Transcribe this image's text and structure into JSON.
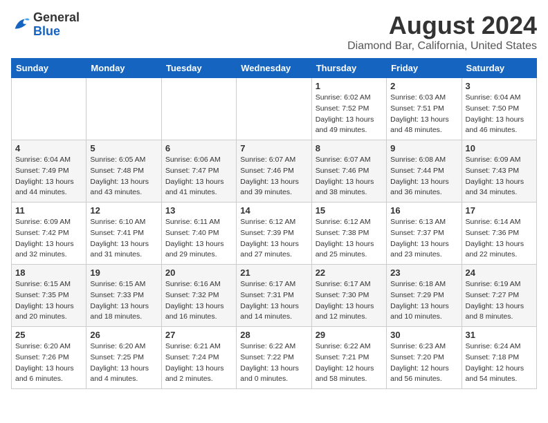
{
  "header": {
    "logo_general": "General",
    "logo_blue": "Blue",
    "month_title": "August 2024",
    "location": "Diamond Bar, California, United States"
  },
  "weekdays": [
    "Sunday",
    "Monday",
    "Tuesday",
    "Wednesday",
    "Thursday",
    "Friday",
    "Saturday"
  ],
  "weeks": [
    [
      {
        "day": "",
        "sunrise": "",
        "sunset": "",
        "daylight": ""
      },
      {
        "day": "",
        "sunrise": "",
        "sunset": "",
        "daylight": ""
      },
      {
        "day": "",
        "sunrise": "",
        "sunset": "",
        "daylight": ""
      },
      {
        "day": "",
        "sunrise": "",
        "sunset": "",
        "daylight": ""
      },
      {
        "day": "1",
        "sunrise": "Sunrise: 6:02 AM",
        "sunset": "Sunset: 7:52 PM",
        "daylight": "Daylight: 13 hours and 49 minutes."
      },
      {
        "day": "2",
        "sunrise": "Sunrise: 6:03 AM",
        "sunset": "Sunset: 7:51 PM",
        "daylight": "Daylight: 13 hours and 48 minutes."
      },
      {
        "day": "3",
        "sunrise": "Sunrise: 6:04 AM",
        "sunset": "Sunset: 7:50 PM",
        "daylight": "Daylight: 13 hours and 46 minutes."
      }
    ],
    [
      {
        "day": "4",
        "sunrise": "Sunrise: 6:04 AM",
        "sunset": "Sunset: 7:49 PM",
        "daylight": "Daylight: 13 hours and 44 minutes."
      },
      {
        "day": "5",
        "sunrise": "Sunrise: 6:05 AM",
        "sunset": "Sunset: 7:48 PM",
        "daylight": "Daylight: 13 hours and 43 minutes."
      },
      {
        "day": "6",
        "sunrise": "Sunrise: 6:06 AM",
        "sunset": "Sunset: 7:47 PM",
        "daylight": "Daylight: 13 hours and 41 minutes."
      },
      {
        "day": "7",
        "sunrise": "Sunrise: 6:07 AM",
        "sunset": "Sunset: 7:46 PM",
        "daylight": "Daylight: 13 hours and 39 minutes."
      },
      {
        "day": "8",
        "sunrise": "Sunrise: 6:07 AM",
        "sunset": "Sunset: 7:46 PM",
        "daylight": "Daylight: 13 hours and 38 minutes."
      },
      {
        "day": "9",
        "sunrise": "Sunrise: 6:08 AM",
        "sunset": "Sunset: 7:44 PM",
        "daylight": "Daylight: 13 hours and 36 minutes."
      },
      {
        "day": "10",
        "sunrise": "Sunrise: 6:09 AM",
        "sunset": "Sunset: 7:43 PM",
        "daylight": "Daylight: 13 hours and 34 minutes."
      }
    ],
    [
      {
        "day": "11",
        "sunrise": "Sunrise: 6:09 AM",
        "sunset": "Sunset: 7:42 PM",
        "daylight": "Daylight: 13 hours and 32 minutes."
      },
      {
        "day": "12",
        "sunrise": "Sunrise: 6:10 AM",
        "sunset": "Sunset: 7:41 PM",
        "daylight": "Daylight: 13 hours and 31 minutes."
      },
      {
        "day": "13",
        "sunrise": "Sunrise: 6:11 AM",
        "sunset": "Sunset: 7:40 PM",
        "daylight": "Daylight: 13 hours and 29 minutes."
      },
      {
        "day": "14",
        "sunrise": "Sunrise: 6:12 AM",
        "sunset": "Sunset: 7:39 PM",
        "daylight": "Daylight: 13 hours and 27 minutes."
      },
      {
        "day": "15",
        "sunrise": "Sunrise: 6:12 AM",
        "sunset": "Sunset: 7:38 PM",
        "daylight": "Daylight: 13 hours and 25 minutes."
      },
      {
        "day": "16",
        "sunrise": "Sunrise: 6:13 AM",
        "sunset": "Sunset: 7:37 PM",
        "daylight": "Daylight: 13 hours and 23 minutes."
      },
      {
        "day": "17",
        "sunrise": "Sunrise: 6:14 AM",
        "sunset": "Sunset: 7:36 PM",
        "daylight": "Daylight: 13 hours and 22 minutes."
      }
    ],
    [
      {
        "day": "18",
        "sunrise": "Sunrise: 6:15 AM",
        "sunset": "Sunset: 7:35 PM",
        "daylight": "Daylight: 13 hours and 20 minutes."
      },
      {
        "day": "19",
        "sunrise": "Sunrise: 6:15 AM",
        "sunset": "Sunset: 7:33 PM",
        "daylight": "Daylight: 13 hours and 18 minutes."
      },
      {
        "day": "20",
        "sunrise": "Sunrise: 6:16 AM",
        "sunset": "Sunset: 7:32 PM",
        "daylight": "Daylight: 13 hours and 16 minutes."
      },
      {
        "day": "21",
        "sunrise": "Sunrise: 6:17 AM",
        "sunset": "Sunset: 7:31 PM",
        "daylight": "Daylight: 13 hours and 14 minutes."
      },
      {
        "day": "22",
        "sunrise": "Sunrise: 6:17 AM",
        "sunset": "Sunset: 7:30 PM",
        "daylight": "Daylight: 13 hours and 12 minutes."
      },
      {
        "day": "23",
        "sunrise": "Sunrise: 6:18 AM",
        "sunset": "Sunset: 7:29 PM",
        "daylight": "Daylight: 13 hours and 10 minutes."
      },
      {
        "day": "24",
        "sunrise": "Sunrise: 6:19 AM",
        "sunset": "Sunset: 7:27 PM",
        "daylight": "Daylight: 13 hours and 8 minutes."
      }
    ],
    [
      {
        "day": "25",
        "sunrise": "Sunrise: 6:20 AM",
        "sunset": "Sunset: 7:26 PM",
        "daylight": "Daylight: 13 hours and 6 minutes."
      },
      {
        "day": "26",
        "sunrise": "Sunrise: 6:20 AM",
        "sunset": "Sunset: 7:25 PM",
        "daylight": "Daylight: 13 hours and 4 minutes."
      },
      {
        "day": "27",
        "sunrise": "Sunrise: 6:21 AM",
        "sunset": "Sunset: 7:24 PM",
        "daylight": "Daylight: 13 hours and 2 minutes."
      },
      {
        "day": "28",
        "sunrise": "Sunrise: 6:22 AM",
        "sunset": "Sunset: 7:22 PM",
        "daylight": "Daylight: 13 hours and 0 minutes."
      },
      {
        "day": "29",
        "sunrise": "Sunrise: 6:22 AM",
        "sunset": "Sunset: 7:21 PM",
        "daylight": "Daylight: 12 hours and 58 minutes."
      },
      {
        "day": "30",
        "sunrise": "Sunrise: 6:23 AM",
        "sunset": "Sunset: 7:20 PM",
        "daylight": "Daylight: 12 hours and 56 minutes."
      },
      {
        "day": "31",
        "sunrise": "Sunrise: 6:24 AM",
        "sunset": "Sunset: 7:18 PM",
        "daylight": "Daylight: 12 hours and 54 minutes."
      }
    ]
  ]
}
